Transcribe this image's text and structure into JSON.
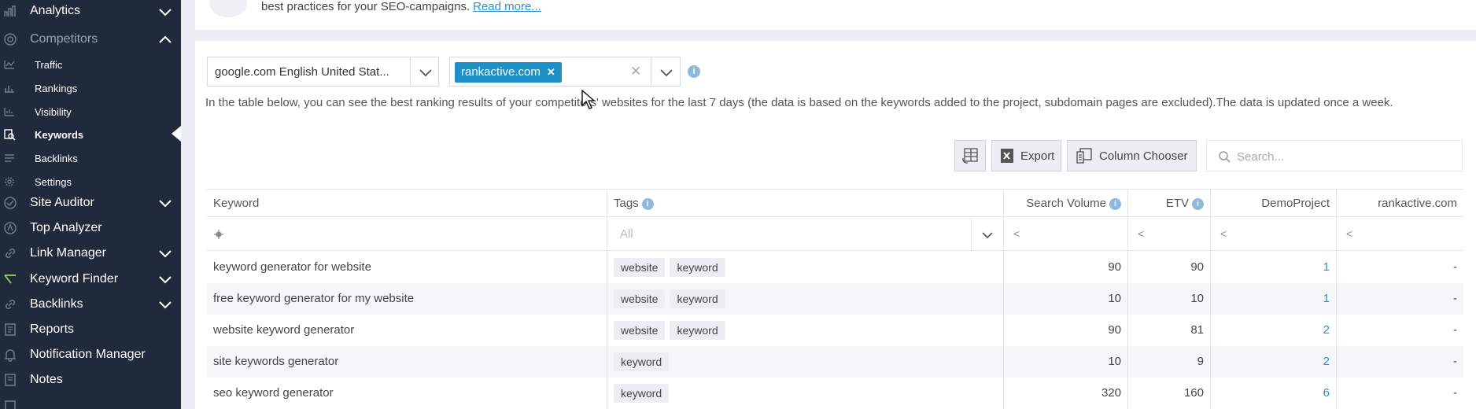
{
  "sidebar": {
    "items": [
      {
        "label": "Analytics",
        "icon": "analytics-icon",
        "chevron": "down"
      },
      {
        "label": "Competitors",
        "icon": "competitors-icon",
        "chevron": "up"
      },
      {
        "label": "Traffic",
        "icon": "traffic-icon",
        "sub": true
      },
      {
        "label": "Rankings",
        "icon": "rankings-icon",
        "sub": true
      },
      {
        "label": "Visibility",
        "icon": "visibility-icon",
        "sub": true
      },
      {
        "label": "Keywords",
        "icon": "keywords-icon",
        "sub": true,
        "active": true
      },
      {
        "label": "Backlinks",
        "icon": "backlinks-icon",
        "sub": true
      },
      {
        "label": "Settings",
        "icon": "settings-icon",
        "sub": true
      },
      {
        "label": "Site Auditor",
        "icon": "site-auditor-icon",
        "chevron": "down"
      },
      {
        "label": "Top Analyzer",
        "icon": "top-analyzer-icon"
      },
      {
        "label": "Link Manager",
        "icon": "link-manager-icon",
        "chevron": "down"
      },
      {
        "label": "Keyword Finder",
        "icon": "keyword-finder-icon",
        "chevron": "down"
      },
      {
        "label": "Backlinks",
        "icon": "backlinks-icon",
        "chevron": "down"
      },
      {
        "label": "Reports",
        "icon": "reports-icon"
      },
      {
        "label": "Notification Manager",
        "icon": "notification-icon"
      },
      {
        "label": "Notes",
        "icon": "notes-icon"
      }
    ]
  },
  "notice": {
    "text": "best practices for your SEO-campaigns.",
    "link": "Read more..."
  },
  "filters": {
    "search_engine": "google.com English United Stat...",
    "competitor_tag": "rankactive.com",
    "description": "In the table below, you can see the best ranking results of your competitors' websites for the last 7 days (the data is based on the keywords added to the project, subdomain pages are excluded).The data is updated once a week."
  },
  "toolbar": {
    "export_label": "Export",
    "column_chooser_label": "Column Chooser",
    "search_placeholder": "Search..."
  },
  "table": {
    "columns": [
      "Keyword",
      "Tags",
      "Search Volume",
      "ETV",
      "DemoProject",
      "rankactive.com"
    ],
    "filter": {
      "tags_placeholder": "All",
      "operator": "<"
    },
    "rows": [
      {
        "keyword": "keyword generator for website",
        "tags": [
          "website",
          "keyword"
        ],
        "volume": "90",
        "etv": "90",
        "demo": "1",
        "rankactive": "-"
      },
      {
        "keyword": "free keyword generator for my website",
        "tags": [
          "website",
          "keyword"
        ],
        "volume": "10",
        "etv": "10",
        "demo": "1",
        "rankactive": "-"
      },
      {
        "keyword": "website keyword generator",
        "tags": [
          "website",
          "keyword"
        ],
        "volume": "90",
        "etv": "81",
        "demo": "2",
        "rankactive": "-"
      },
      {
        "keyword": "site keywords generator",
        "tags": [
          "keyword"
        ],
        "volume": "10",
        "etv": "9",
        "demo": "2",
        "rankactive": "-"
      },
      {
        "keyword": "seo keyword generator",
        "tags": [
          "keyword"
        ],
        "volume": "320",
        "etv": "160",
        "demo": "6",
        "rankactive": "-"
      }
    ]
  },
  "colors": {
    "sidebar_bg": "#1f2a3c",
    "accent": "#1e90c8",
    "link": "#2b8fd3"
  }
}
